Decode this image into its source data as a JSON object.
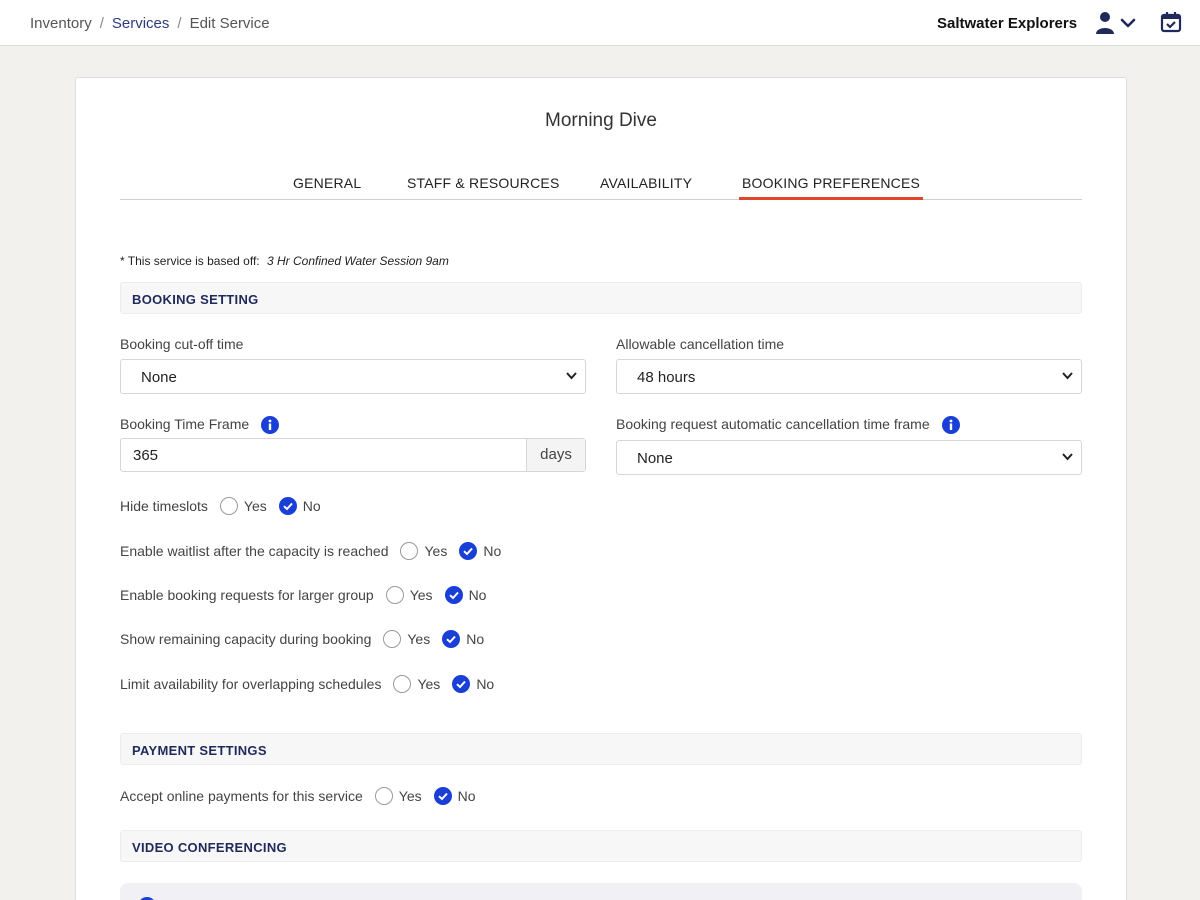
{
  "breadcrumb": {
    "items": [
      "Inventory",
      "Services",
      "Edit Service"
    ],
    "separator": "/"
  },
  "header": {
    "company": "Saltwater Explorers"
  },
  "icons": {
    "user": "user-icon",
    "dropdown": "chevron-down-icon",
    "calendar": "calendar-check-icon",
    "info": "info-icon"
  },
  "page": {
    "title": "Morning Dive",
    "tabs": [
      "GENERAL",
      "STAFF & RESOURCES",
      "AVAILABILITY",
      "BOOKING PREFERENCES"
    ],
    "active_tab": "BOOKING PREFERENCES",
    "based_off_label": "* This service is based off:",
    "based_off_value": "3 Hr Confined Water Session 9am"
  },
  "booking_setting": {
    "title": "BOOKING SETTING",
    "cutoff_label": "Booking cut-off time",
    "cutoff_value": "None",
    "cancellation_label": "Allowable cancellation time",
    "cancellation_value": "48 hours",
    "timeframe_label": "Booking Time Frame",
    "timeframe_value": "365",
    "timeframe_unit": "days",
    "auto_cancel_label": "Booking request automatic cancellation time frame",
    "auto_cancel_value": "None",
    "yes_label": "Yes",
    "no_label": "No",
    "options": [
      {
        "label": "Hide timeslots",
        "selected": "No"
      },
      {
        "label": "Enable waitlist after the capacity is reached",
        "selected": "No"
      },
      {
        "label": "Enable booking requests for larger group",
        "selected": "No"
      },
      {
        "label": "Show remaining capacity during booking",
        "selected": "No"
      },
      {
        "label": "Limit availability for overlapping schedules",
        "selected": "No"
      }
    ]
  },
  "payment_settings": {
    "title": "PAYMENT SETTINGS",
    "online_label": "Accept online payments for this service",
    "selected": "No"
  },
  "video_conferencing": {
    "title": "VIDEO CONFERENCING"
  },
  "colors": {
    "accent": "#e0462a",
    "primary": "#1a3fd6",
    "heading": "#1f2a5a",
    "link": "#2c3d7a"
  }
}
